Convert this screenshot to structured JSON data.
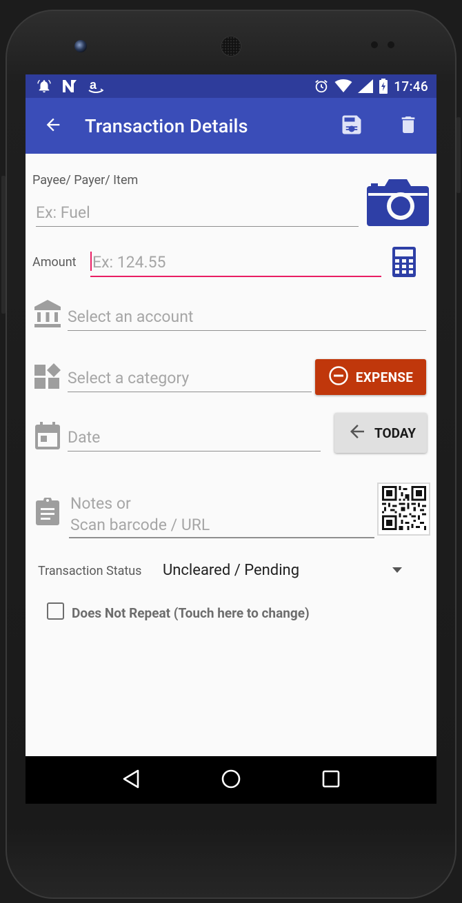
{
  "statusbar": {
    "time": "17:46",
    "left_icons": [
      "alarm-bell-icon",
      "n-notification-icon",
      "amazon-icon"
    ],
    "right_icons": [
      "alarm-clock-icon",
      "wifi-icon",
      "signal-icon",
      "battery-charging-icon"
    ]
  },
  "appbar": {
    "title": "Transaction Details",
    "back_icon": "arrow-back-icon",
    "actions": [
      "save-icon",
      "delete-icon"
    ]
  },
  "form": {
    "payee_label": "Payee/ Payer/ Item",
    "payee_placeholder": "Ex: Fuel",
    "amount_label": "Amount",
    "amount_placeholder": "Ex: 124.55",
    "account_placeholder": "Select an account",
    "category_placeholder": "Select a category",
    "expense_button": "EXPENSE",
    "date_placeholder": "Date",
    "today_button": "TODAY",
    "notes_line1": "Notes or",
    "notes_line2": "Scan barcode / URL",
    "status_label": "Transaction Status",
    "status_value": "Uncleared / Pending",
    "repeat_label": "Does Not Repeat (Touch here to change)"
  },
  "colors": {
    "statusbar": "#2e3c9b",
    "appbar": "#3a4db8",
    "accent": "#e91e63",
    "expense": "#c0370b",
    "icon_blue": "#2e3fa6"
  }
}
